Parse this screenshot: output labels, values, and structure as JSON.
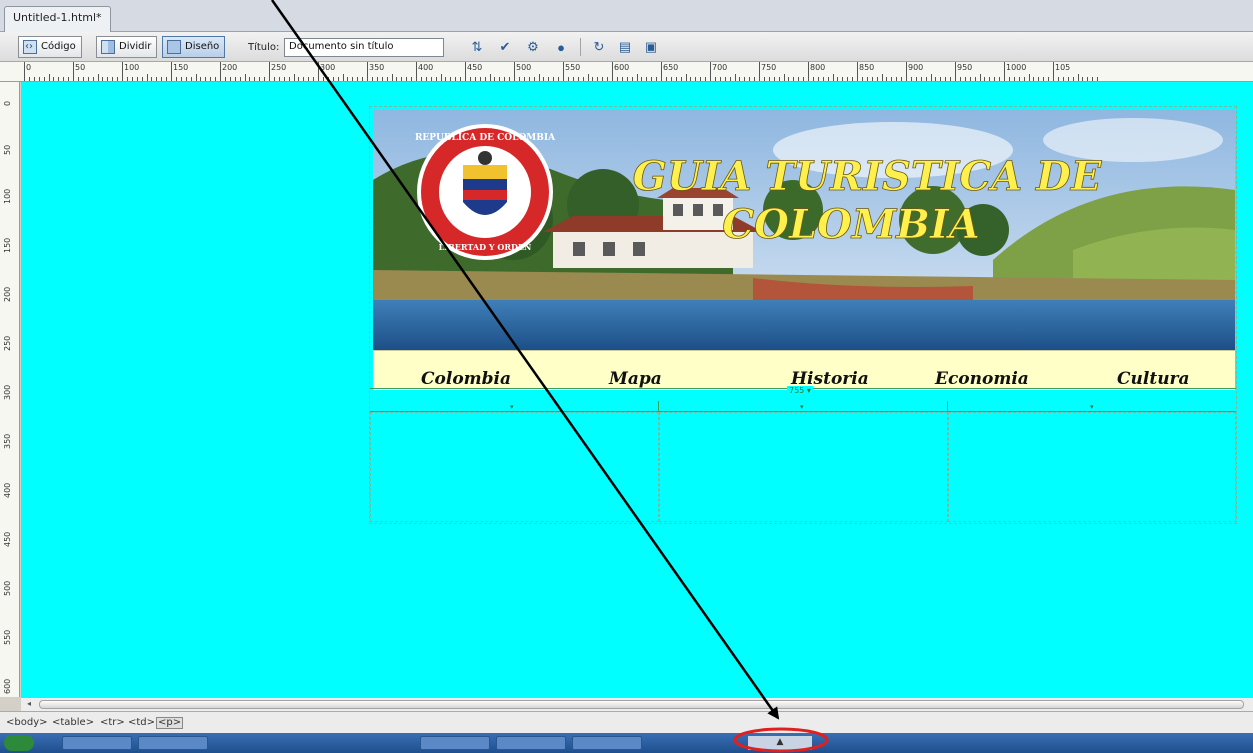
{
  "document": {
    "tab_label": "Untitled-1.html*"
  },
  "toolbar": {
    "code_label": "Código",
    "split_label": "Dividir",
    "design_label": "Diseño",
    "title_label": "Título:",
    "title_value": "Documento sin título"
  },
  "rulers": {
    "top_labels": [
      "0",
      "50",
      "100",
      "150",
      "200",
      "250",
      "300",
      "350",
      "400",
      "450",
      "500",
      "550",
      "600",
      "650",
      "700",
      "750",
      "800",
      "850",
      "900",
      "950",
      "1000",
      "105"
    ],
    "left_labels": [
      "0",
      "50",
      "100",
      "150",
      "200",
      "250",
      "300",
      "350",
      "400",
      "450",
      "500",
      "550",
      "600"
    ]
  },
  "page": {
    "banner_title_line1": "GUIA TURISTICA DE",
    "banner_title_line2": "COLOMBIA",
    "seal_text_top": "REPUBLICA DE COLOMBIA",
    "seal_text_bottom": "LIBERTAD Y ORDEN",
    "nav_items": [
      "Colombia",
      "Mapa",
      "Historia",
      "Economia",
      "Cultura"
    ],
    "table_width_marker": "755 ▾"
  },
  "statusbar": {
    "tags": [
      "<body>",
      "<table>",
      "<tr>",
      "<td>",
      "<p>"
    ]
  },
  "taskbar": {
    "center_arrow": "▲"
  },
  "colors": {
    "canvas_bg": "#00ffff",
    "nav_bg": "#ffffc8",
    "banner_title": "#ffee55",
    "annotation": "#e02020"
  }
}
